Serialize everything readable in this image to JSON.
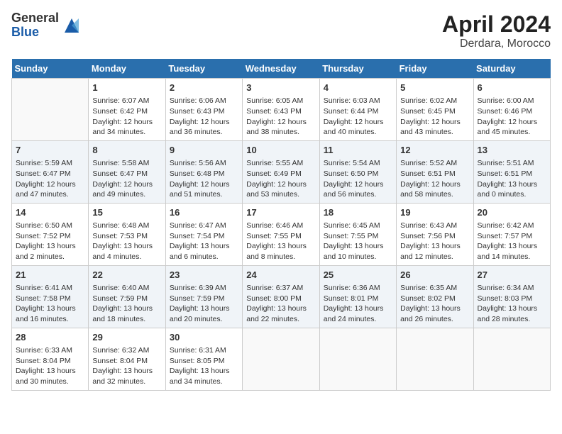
{
  "header": {
    "logo_general": "General",
    "logo_blue": "Blue",
    "month": "April 2024",
    "location": "Derdara, Morocco"
  },
  "days_of_week": [
    "Sunday",
    "Monday",
    "Tuesday",
    "Wednesday",
    "Thursday",
    "Friday",
    "Saturday"
  ],
  "weeks": [
    [
      {
        "day": "",
        "sunrise": "",
        "sunset": "",
        "daylight": ""
      },
      {
        "day": "1",
        "sunrise": "Sunrise: 6:07 AM",
        "sunset": "Sunset: 6:42 PM",
        "daylight": "Daylight: 12 hours and 34 minutes."
      },
      {
        "day": "2",
        "sunrise": "Sunrise: 6:06 AM",
        "sunset": "Sunset: 6:43 PM",
        "daylight": "Daylight: 12 hours and 36 minutes."
      },
      {
        "day": "3",
        "sunrise": "Sunrise: 6:05 AM",
        "sunset": "Sunset: 6:43 PM",
        "daylight": "Daylight: 12 hours and 38 minutes."
      },
      {
        "day": "4",
        "sunrise": "Sunrise: 6:03 AM",
        "sunset": "Sunset: 6:44 PM",
        "daylight": "Daylight: 12 hours and 40 minutes."
      },
      {
        "day": "5",
        "sunrise": "Sunrise: 6:02 AM",
        "sunset": "Sunset: 6:45 PM",
        "daylight": "Daylight: 12 hours and 43 minutes."
      },
      {
        "day": "6",
        "sunrise": "Sunrise: 6:00 AM",
        "sunset": "Sunset: 6:46 PM",
        "daylight": "Daylight: 12 hours and 45 minutes."
      }
    ],
    [
      {
        "day": "7",
        "sunrise": "Sunrise: 5:59 AM",
        "sunset": "Sunset: 6:47 PM",
        "daylight": "Daylight: 12 hours and 47 minutes."
      },
      {
        "day": "8",
        "sunrise": "Sunrise: 5:58 AM",
        "sunset": "Sunset: 6:47 PM",
        "daylight": "Daylight: 12 hours and 49 minutes."
      },
      {
        "day": "9",
        "sunrise": "Sunrise: 5:56 AM",
        "sunset": "Sunset: 6:48 PM",
        "daylight": "Daylight: 12 hours and 51 minutes."
      },
      {
        "day": "10",
        "sunrise": "Sunrise: 5:55 AM",
        "sunset": "Sunset: 6:49 PM",
        "daylight": "Daylight: 12 hours and 53 minutes."
      },
      {
        "day": "11",
        "sunrise": "Sunrise: 5:54 AM",
        "sunset": "Sunset: 6:50 PM",
        "daylight": "Daylight: 12 hours and 56 minutes."
      },
      {
        "day": "12",
        "sunrise": "Sunrise: 5:52 AM",
        "sunset": "Sunset: 6:51 PM",
        "daylight": "Daylight: 12 hours and 58 minutes."
      },
      {
        "day": "13",
        "sunrise": "Sunrise: 5:51 AM",
        "sunset": "Sunset: 6:51 PM",
        "daylight": "Daylight: 13 hours and 0 minutes."
      }
    ],
    [
      {
        "day": "14",
        "sunrise": "Sunrise: 6:50 AM",
        "sunset": "Sunset: 7:52 PM",
        "daylight": "Daylight: 13 hours and 2 minutes."
      },
      {
        "day": "15",
        "sunrise": "Sunrise: 6:48 AM",
        "sunset": "Sunset: 7:53 PM",
        "daylight": "Daylight: 13 hours and 4 minutes."
      },
      {
        "day": "16",
        "sunrise": "Sunrise: 6:47 AM",
        "sunset": "Sunset: 7:54 PM",
        "daylight": "Daylight: 13 hours and 6 minutes."
      },
      {
        "day": "17",
        "sunrise": "Sunrise: 6:46 AM",
        "sunset": "Sunset: 7:55 PM",
        "daylight": "Daylight: 13 hours and 8 minutes."
      },
      {
        "day": "18",
        "sunrise": "Sunrise: 6:45 AM",
        "sunset": "Sunset: 7:55 PM",
        "daylight": "Daylight: 13 hours and 10 minutes."
      },
      {
        "day": "19",
        "sunrise": "Sunrise: 6:43 AM",
        "sunset": "Sunset: 7:56 PM",
        "daylight": "Daylight: 13 hours and 12 minutes."
      },
      {
        "day": "20",
        "sunrise": "Sunrise: 6:42 AM",
        "sunset": "Sunset: 7:57 PM",
        "daylight": "Daylight: 13 hours and 14 minutes."
      }
    ],
    [
      {
        "day": "21",
        "sunrise": "Sunrise: 6:41 AM",
        "sunset": "Sunset: 7:58 PM",
        "daylight": "Daylight: 13 hours and 16 minutes."
      },
      {
        "day": "22",
        "sunrise": "Sunrise: 6:40 AM",
        "sunset": "Sunset: 7:59 PM",
        "daylight": "Daylight: 13 hours and 18 minutes."
      },
      {
        "day": "23",
        "sunrise": "Sunrise: 6:39 AM",
        "sunset": "Sunset: 7:59 PM",
        "daylight": "Daylight: 13 hours and 20 minutes."
      },
      {
        "day": "24",
        "sunrise": "Sunrise: 6:37 AM",
        "sunset": "Sunset: 8:00 PM",
        "daylight": "Daylight: 13 hours and 22 minutes."
      },
      {
        "day": "25",
        "sunrise": "Sunrise: 6:36 AM",
        "sunset": "Sunset: 8:01 PM",
        "daylight": "Daylight: 13 hours and 24 minutes."
      },
      {
        "day": "26",
        "sunrise": "Sunrise: 6:35 AM",
        "sunset": "Sunset: 8:02 PM",
        "daylight": "Daylight: 13 hours and 26 minutes."
      },
      {
        "day": "27",
        "sunrise": "Sunrise: 6:34 AM",
        "sunset": "Sunset: 8:03 PM",
        "daylight": "Daylight: 13 hours and 28 minutes."
      }
    ],
    [
      {
        "day": "28",
        "sunrise": "Sunrise: 6:33 AM",
        "sunset": "Sunset: 8:04 PM",
        "daylight": "Daylight: 13 hours and 30 minutes."
      },
      {
        "day": "29",
        "sunrise": "Sunrise: 6:32 AM",
        "sunset": "Sunset: 8:04 PM",
        "daylight": "Daylight: 13 hours and 32 minutes."
      },
      {
        "day": "30",
        "sunrise": "Sunrise: 6:31 AM",
        "sunset": "Sunset: 8:05 PM",
        "daylight": "Daylight: 13 hours and 34 minutes."
      },
      {
        "day": "",
        "sunrise": "",
        "sunset": "",
        "daylight": ""
      },
      {
        "day": "",
        "sunrise": "",
        "sunset": "",
        "daylight": ""
      },
      {
        "day": "",
        "sunrise": "",
        "sunset": "",
        "daylight": ""
      },
      {
        "day": "",
        "sunrise": "",
        "sunset": "",
        "daylight": ""
      }
    ]
  ]
}
